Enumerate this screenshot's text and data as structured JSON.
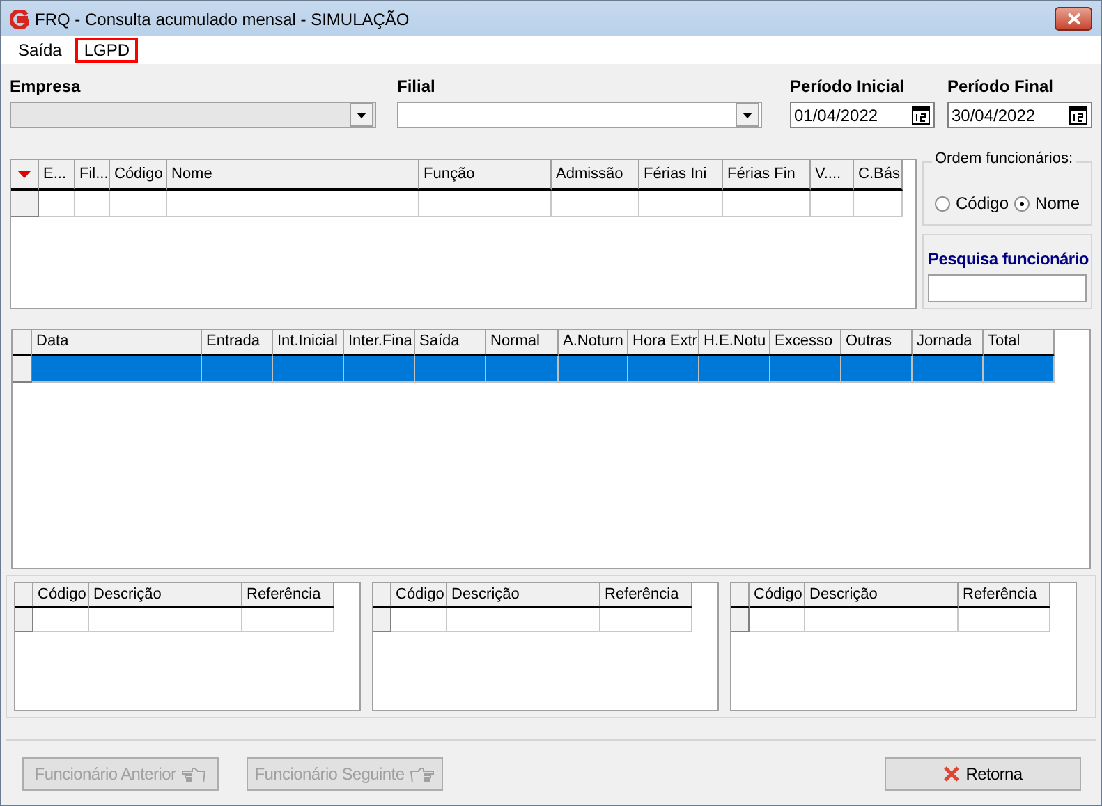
{
  "window": {
    "title": "FRQ - Consulta acumulado mensal - SIMULAÇÃO"
  },
  "menu": [
    {
      "label": "Saída",
      "highlighted": false
    },
    {
      "label": "LGPD",
      "highlighted": true
    }
  ],
  "filters": {
    "empresa": {
      "label": "Empresa",
      "disabled": true
    },
    "filial": {
      "label": "Filial",
      "disabled": false
    },
    "periodo_inicial": {
      "label": "Período Inicial",
      "value": "01/04/2022"
    },
    "periodo_final": {
      "label": "Período Final",
      "value": "30/04/2022"
    }
  },
  "employee_table": {
    "columns": [
      "E...",
      "Fil...",
      "Código",
      "Nome",
      "Função",
      "Admissão",
      "Férias Ini",
      "Férias Fin",
      "V....",
      "C.Bás"
    ],
    "rows": [
      {
        "selected": false
      }
    ]
  },
  "ordem": {
    "title": "Ordem funcionários:",
    "options": [
      {
        "label": "Código",
        "selected": false
      },
      {
        "label": "Nome",
        "selected": true
      }
    ]
  },
  "pesquisa": {
    "label": "Pesquisa funcionário"
  },
  "day_table": {
    "columns": [
      "Data",
      "Entrada",
      "Int.Inicial",
      "Inter.Fina",
      "Saída",
      "Normal",
      "A.Noturn",
      "Hora Extr",
      "H.E.Notu",
      "Excesso",
      "Outras",
      "Jornada",
      "Total"
    ],
    "rows": [
      {
        "selected": true
      }
    ]
  },
  "detail_tables": [
    {
      "columns": [
        "Código",
        "Descrição",
        "Referência"
      ]
    },
    {
      "columns": [
        "Código",
        "Descrição",
        "Referência"
      ]
    },
    {
      "columns": [
        "Código",
        "Descrição",
        "Referência"
      ]
    }
  ],
  "buttons": [
    {
      "label": "Funcionário Anterior",
      "kind": "previous",
      "disabled": true
    },
    {
      "label": "Funcionário Seguinte",
      "kind": "next",
      "disabled": true
    },
    {
      "label": "Retorna",
      "kind": "close",
      "disabled": false
    }
  ]
}
